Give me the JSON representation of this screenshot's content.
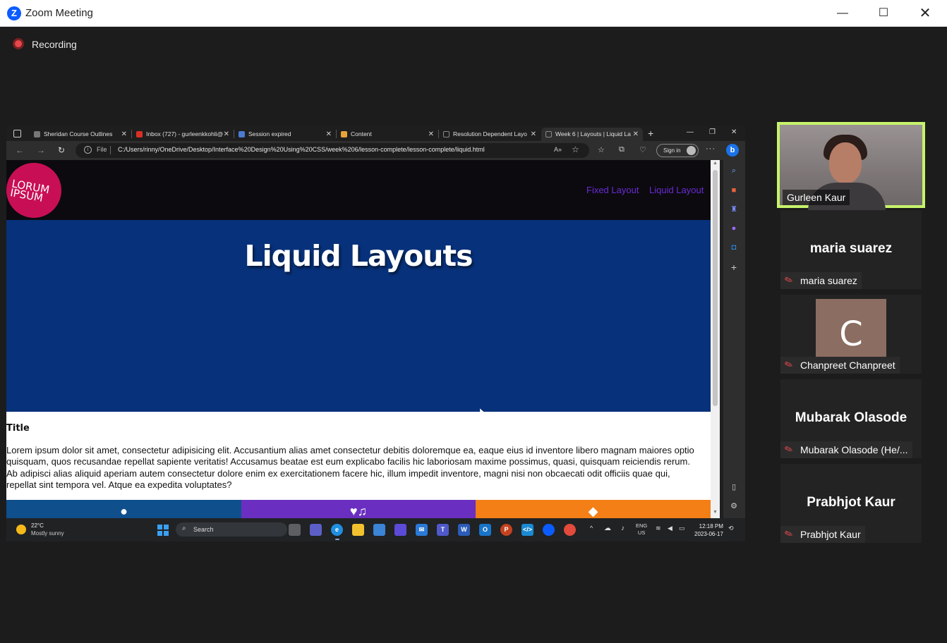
{
  "window": {
    "title": "Zoom Meeting",
    "logo_letter": "Z",
    "minimize": "—",
    "maximize": "☐",
    "close": "✕"
  },
  "recording": {
    "label": "Recording",
    "color": "#e5484d"
  },
  "browser": {
    "tabs": [
      {
        "label": "Sheridan Course Outlines",
        "favicon_color": "#777777"
      },
      {
        "label": "Inbox (727) - gurleenkkohli@",
        "favicon_color": "#d93025"
      },
      {
        "label": "Session expired",
        "favicon_color": "#4a7bd0"
      },
      {
        "label": "Content",
        "favicon_color": "#e8a23a"
      },
      {
        "label": "Resolution Dependent Layo",
        "favicon_color": "#888888"
      },
      {
        "label": "Week 6 | Layouts | Liquid La",
        "favicon_color": "#888888"
      }
    ],
    "tab_close": "✕",
    "new_tab": "+",
    "address": {
      "protocol_label": "File",
      "url": "C:/Users/rinny/OneDrive/Desktop/Interface%20Design%20Using%20CSS/week%206/lesson-complete/lesson-complete/liquid.html",
      "read_aloud": "A»"
    },
    "sign_in": "Sign in",
    "more": "···"
  },
  "site": {
    "logo_text": "LORUM IPSUM",
    "nav": [
      "Fixed Layout",
      "Liquid Layout"
    ],
    "hero_title": "Liquid Layouts",
    "content_title": "Title",
    "content_lines": [
      "Lorem ipsum dolor sit amet, consectetur adipisicing elit. Accusantium alias amet consectetur debitis doloremque ea, eaque eius id inventore libero magnam maiores optio",
      "quisquam, quos recusandae repellat sapiente veritatis! Accusamus beatae est eum explicabo facilis hic laboriosam maxime possimus, quasi, quisquam reiciendis rerum.",
      "Ab adipisci alias aliquid aperiam autem consectetur dolore enim ex exercitationem facere hic, illum impedit inventore, magni nisi non obcaecati odit officiis quae qui,",
      "repellat sint tempora vel. Atque ea expedita voluptates?"
    ],
    "feature_icons": [
      "palette-icon",
      "music-heart-icon",
      "layers-icon"
    ],
    "colors": {
      "header": "#0c0a0e",
      "hero": "#07317a",
      "nav_link": "#6a2ad6",
      "logo": "#c80f56"
    }
  },
  "taskbar": {
    "weather_temp": "22°C",
    "weather_desc": "Mostly sunny",
    "search_label": "Search",
    "lang_1": "ENG",
    "lang_2": "US",
    "time": "12:18 PM",
    "date": "2023-06-17"
  },
  "participants": [
    {
      "name": "Gurleen Kaur",
      "video": true,
      "active_speaker": true
    },
    {
      "name": "maria suarez",
      "display": "maria suarez",
      "muted": true
    },
    {
      "name": "Chanpreet Chanpreet",
      "avatar_letter": "C",
      "muted": true
    },
    {
      "name": "Mubarak Olasode (He/...",
      "display": "Mubarak Olasode",
      "muted": true
    },
    {
      "name": "Prabhjot Kaur",
      "display": "Prabhjot Kaur",
      "muted": true
    }
  ]
}
